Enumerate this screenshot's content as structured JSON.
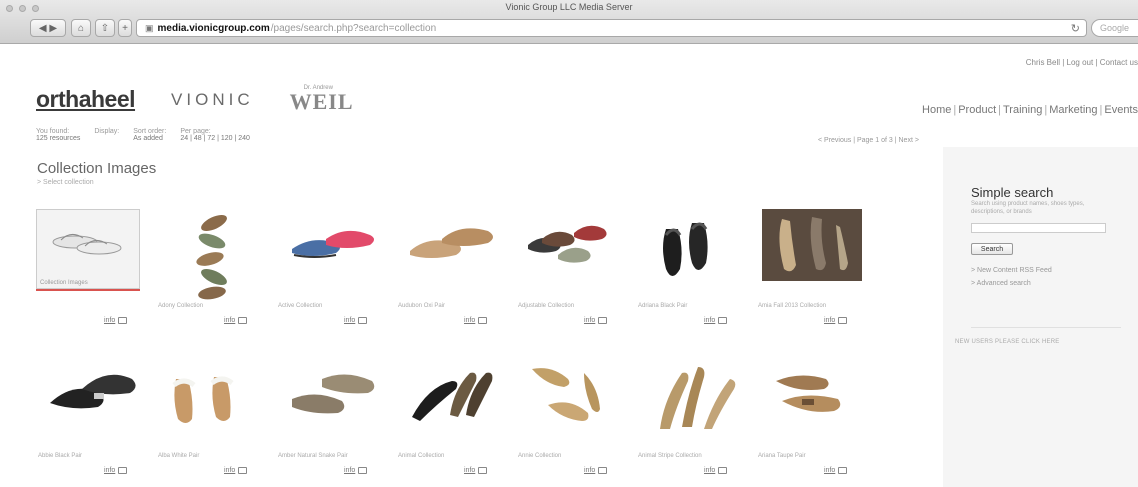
{
  "browser": {
    "window_title": "Vionic Group LLC Media Server",
    "url_host": "media.vionicgroup.com",
    "url_path": "/pages/search.php?search=collection",
    "search_placeholder": "Google"
  },
  "header": {
    "top_links": "Chris Bell | Log out | Contact us",
    "logos": {
      "orthoheel": "orthaheel",
      "vionic": "VIONIC",
      "weil_small": "Dr. Andrew",
      "weil": "WEIL"
    },
    "nav": [
      "Home",
      "Product",
      "Training",
      "Marketing",
      "Events"
    ]
  },
  "filters": {
    "found_label": "You found:",
    "found_value": "125 resources",
    "display_label": "Display:",
    "sort_label": "Sort order:",
    "sort_value": "As added",
    "perpage_label": "Per page:",
    "perpage_options": "24 | 48 | 72 | 120 | 240",
    "pager": "< Previous | Page 1 of 3 | Next >"
  },
  "section": {
    "title": "Collection Images",
    "subtitle": "> Select collection"
  },
  "tiles": [
    {
      "caption": "Collection Images",
      "icon": "collection-folder"
    },
    {
      "caption": "Adony Collection",
      "icon": "shoe-photo"
    },
    {
      "caption": "Active Collection",
      "icon": "shoe-photo"
    },
    {
      "caption": "Audubon Oxi Pair",
      "icon": "shoe-photo"
    },
    {
      "caption": "Adjustable Collection",
      "icon": "shoe-photo"
    },
    {
      "caption": "Adriana Black Pair",
      "icon": "shoe-photo"
    },
    {
      "caption": "Amia Fall 2013 Collection",
      "icon": "shoe-photo"
    },
    {
      "caption": "Abbie Black Pair",
      "icon": "shoe-photo"
    },
    {
      "caption": "Alba White Pair",
      "icon": "shoe-photo"
    },
    {
      "caption": "Amber Natural Snake Pair",
      "icon": "shoe-photo"
    },
    {
      "caption": "Animal Collection",
      "icon": "shoe-photo"
    },
    {
      "caption": "Annie Collection",
      "icon": "shoe-photo"
    },
    {
      "caption": "Animal Stripe Collection",
      "icon": "shoe-photo"
    },
    {
      "caption": "Ariana Taupe Pair",
      "icon": "shoe-photo"
    }
  ],
  "tile_actions": {
    "info": "info"
  },
  "sidebar": {
    "title": "Simple search",
    "description": "Search using product names, shoes types, descriptions, or brands",
    "search_button": "Search",
    "link1": "> New Content RSS Feed",
    "link2": "> Advanced search",
    "notice": "NEW USERS PLEASE CLICK HERE"
  },
  "colors": {
    "accent_red": "#d9534f"
  }
}
